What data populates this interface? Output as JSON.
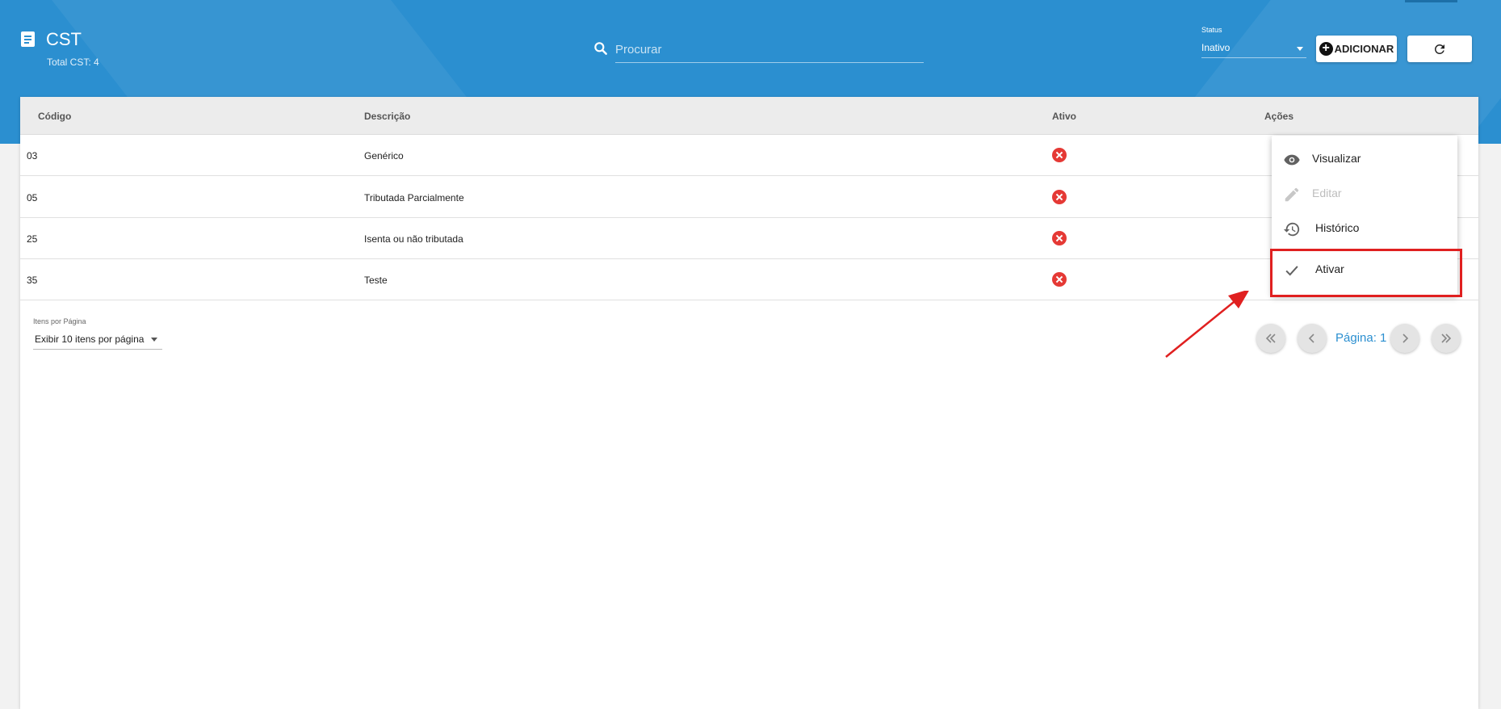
{
  "header": {
    "title": "CST",
    "subtitle": "Total CST: 4",
    "search_placeholder": "Procurar",
    "status_label": "Status",
    "status_value": "Inativo",
    "add_label": "ADICIONAR",
    "icons": {
      "title": "document-icon",
      "search": "search-icon",
      "add": "plus-circle-icon",
      "refresh": "refresh-icon"
    }
  },
  "table": {
    "columns": [
      "Código",
      "Descrição",
      "Ativo",
      "Ações"
    ],
    "rows": [
      {
        "codigo": "03",
        "descricao": "Genérico",
        "ativo": "inactive"
      },
      {
        "codigo": "05",
        "descricao": "Tributada Parcialmente",
        "ativo": "inactive"
      },
      {
        "codigo": "25",
        "descricao": "Isenta ou não tributada",
        "ativo": "inactive"
      },
      {
        "codigo": "35",
        "descricao": "Teste",
        "ativo": "inactive"
      }
    ],
    "status_colors": {
      "inactive": "#e53935"
    }
  },
  "pagination": {
    "per_page_label": "Itens por Página",
    "per_page_value": "Exibir 10 itens por página",
    "page_label": "Página: 1"
  },
  "actions_menu": {
    "items": [
      {
        "label": "Visualizar",
        "icon": "eye-icon",
        "enabled": true
      },
      {
        "label": "Editar",
        "icon": "pencil-icon",
        "enabled": false
      },
      {
        "label": "Histórico",
        "icon": "history-icon",
        "enabled": true
      },
      {
        "label": "Ativar",
        "icon": "check-icon",
        "enabled": true
      }
    ]
  },
  "colors": {
    "header": "#2b8fd0",
    "accent": "#2b8fd0",
    "highlight": "#e02020"
  }
}
